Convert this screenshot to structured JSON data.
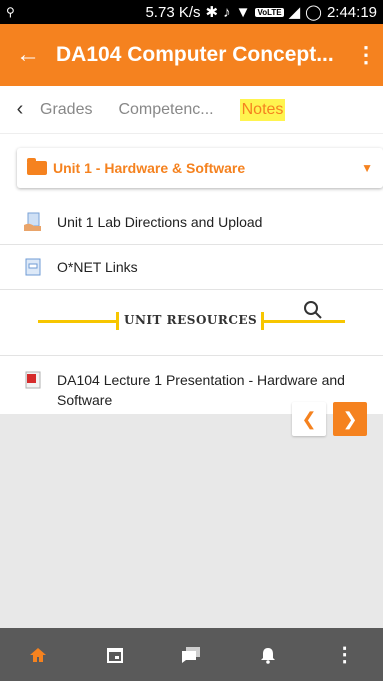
{
  "status_bar": {
    "network_speed": "5.73 K/s",
    "network_badge": "VoLTE",
    "time": "2:44:19"
  },
  "app_bar": {
    "title": "DA104 Computer Concept...",
    "back_icon": "arrow-back-icon",
    "more_icon": "more-vert-icon"
  },
  "tabs": {
    "items": [
      {
        "label": "Grades"
      },
      {
        "label": "Competenc..."
      },
      {
        "label": "Notes"
      }
    ],
    "active": "Notes",
    "highlight_color": "#fff44f"
  },
  "unit_select": {
    "value": "Unit 1 - Hardware & Software"
  },
  "list": {
    "items": [
      {
        "label": "Unit 1 Lab Directions and Upload",
        "icon": "upload-doc-icon"
      },
      {
        "label": "O*NET Links",
        "icon": "link-doc-icon"
      }
    ],
    "banner_text": "UNIT RESOURCES",
    "presentation": {
      "label": "DA104 Lecture 1 Presentation - Hardware and Software",
      "icon": "pdf-icon"
    }
  },
  "pager": {
    "prev_icon": "chevron-left-icon",
    "next_icon": "chevron-right-icon"
  },
  "bottom_nav": [
    {
      "icon": "home-icon",
      "active": true
    },
    {
      "icon": "calendar-icon",
      "active": false
    },
    {
      "icon": "chat-icon",
      "active": false
    },
    {
      "icon": "bell-icon",
      "active": false
    },
    {
      "icon": "more-vert-icon",
      "active": false
    }
  ],
  "colors": {
    "accent": "#f5821f",
    "nav_bg": "#5a5a5a",
    "banner_line": "#f7c600"
  }
}
